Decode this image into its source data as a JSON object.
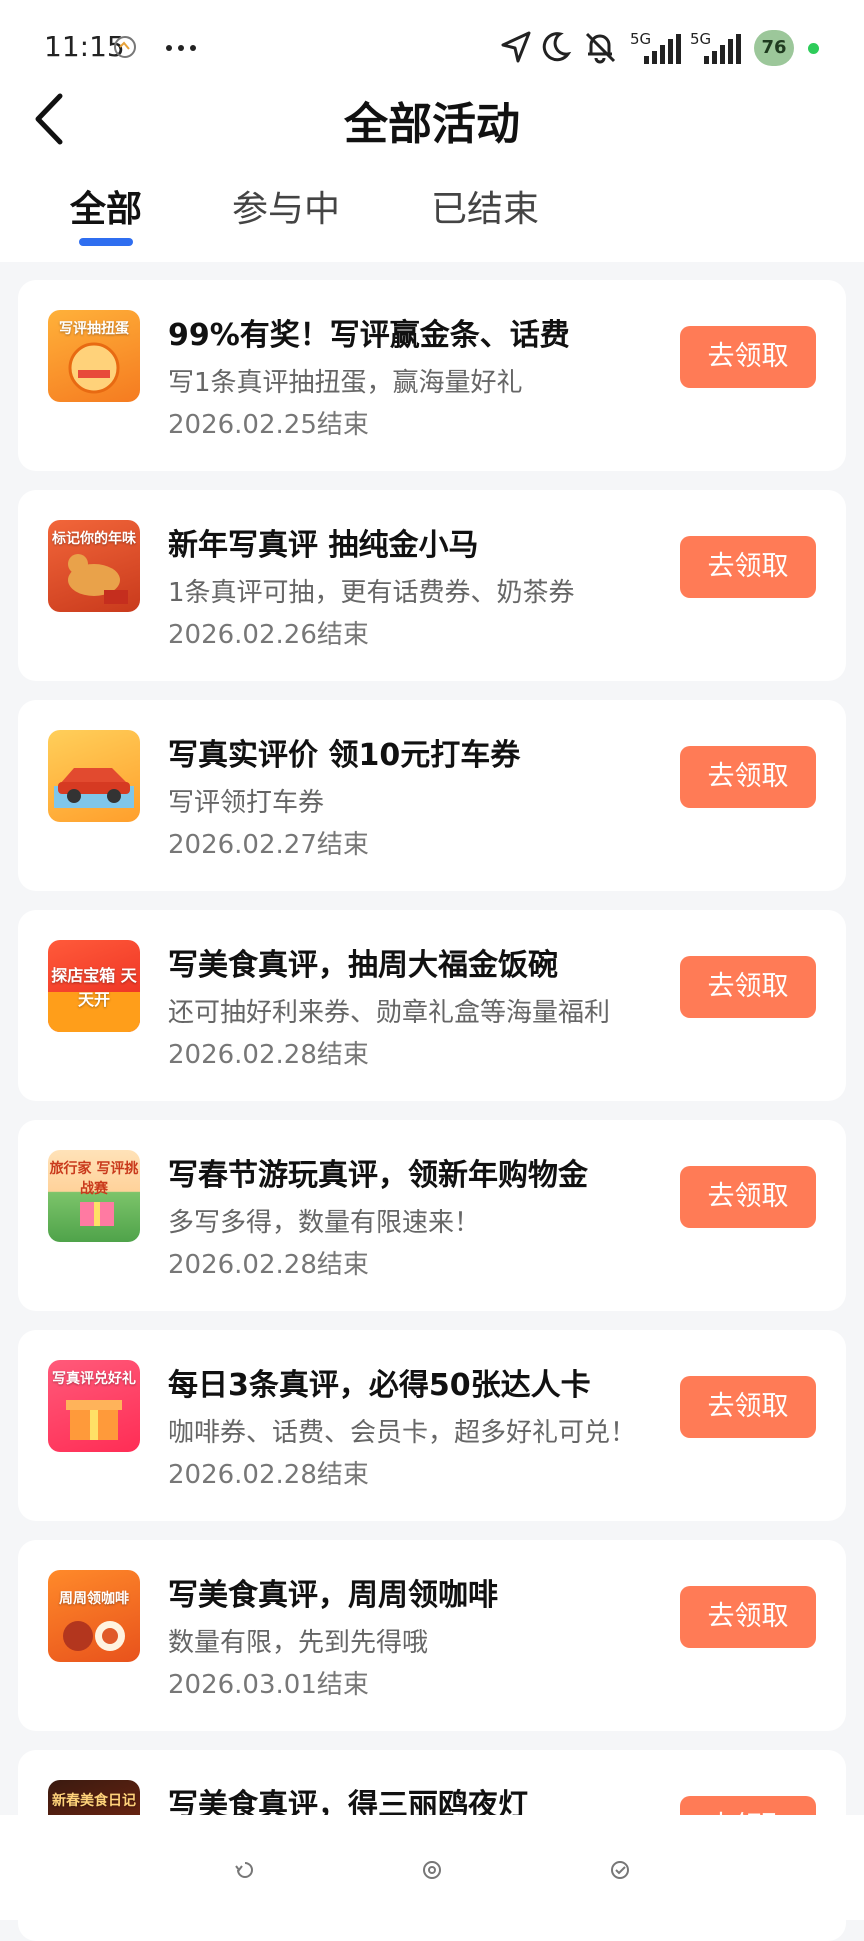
{
  "status_bar": {
    "time": "11:15",
    "net1": "5G",
    "net2": "5G",
    "battery": "76"
  },
  "header": {
    "title": "全部活动",
    "tabs": [
      {
        "label": "全部"
      },
      {
        "label": "参与中"
      },
      {
        "label": "已结束"
      }
    ]
  },
  "activities": [
    {
      "thumb_text": "写评抽扭蛋",
      "title": "99%有奖！写评赢金条、话费",
      "subtitle": "写1条真评抽扭蛋，赢海量好礼",
      "date": "2026.02.25结束",
      "button": "去领取"
    },
    {
      "thumb_text": "标记你的年味",
      "title": "新年写真评 抽纯金小马",
      "subtitle": "1条真评可抽，更有话费券、奶茶券",
      "date": "2026.02.26结束",
      "button": "去领取"
    },
    {
      "thumb_text": "",
      "title": "写真实评价 领10元打车券",
      "subtitle": "写评领打车券",
      "date": "2026.02.27结束",
      "button": "去领取"
    },
    {
      "thumb_text": "探店宝箱 天天开",
      "title": "写美食真评，抽周大福金饭碗",
      "subtitle": "还可抽好利来券、勋章礼盒等海量福利",
      "date": "2026.02.28结束",
      "button": "去领取"
    },
    {
      "thumb_text": "旅行家 写评挑战赛",
      "title": "写春节游玩真评，领新年购物金",
      "subtitle": "多写多得，数量有限速来！",
      "date": "2026.02.28结束",
      "button": "去领取"
    },
    {
      "thumb_text": "写真评兑好礼",
      "title": "每日3条真评，必得50张达人卡",
      "subtitle": "咖啡券、话费、会员卡，超多好礼可兑！",
      "date": "2026.02.28结束",
      "button": "去领取"
    },
    {
      "thumb_text": "周周领咖啡",
      "title": "写美食真评，周周领咖啡",
      "subtitle": "数量有限，先到先得哦",
      "date": "2026.03.01结束",
      "button": "去领取"
    },
    {
      "thumb_text": "新春美食日记",
      "title": "写美食真评，得三丽鸥夜灯",
      "subtitle": "",
      "date": "",
      "button": "去领取"
    }
  ],
  "colors": {
    "accent_button": "#ff7b56",
    "tab_indicator": "#2f6ef0",
    "page_bg": "#f5f6f8"
  }
}
